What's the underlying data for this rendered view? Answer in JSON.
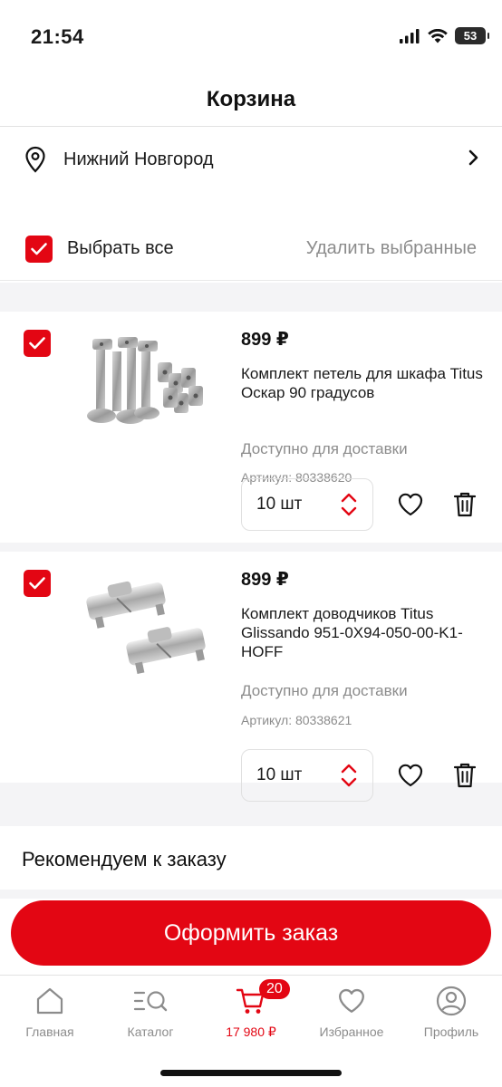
{
  "status_bar": {
    "time": "21:54",
    "battery": "53"
  },
  "header": {
    "title": "Корзина"
  },
  "location": {
    "city": "Нижний Новгород"
  },
  "selection": {
    "select_all_label": "Выбрать все",
    "delete_selected_label": "Удалить выбранные"
  },
  "items": [
    {
      "price": "899 ₽",
      "name": "Комплект петель для шкафа Titus Оскар 90 градусов",
      "availability": "Доступно для доставки",
      "sku": "Артикул: 80338620",
      "quantity": "10 шт"
    },
    {
      "price": "899 ₽",
      "name": "Комплект доводчиков Titus Glissando 951-0X94-050-00-K1-HOFF",
      "availability": "Доступно для доставки",
      "sku": "Артикул: 80338621",
      "quantity": "10 шт"
    }
  ],
  "recommend": {
    "title": "Рекомендуем к заказу"
  },
  "checkout": {
    "label": "Оформить заказ"
  },
  "tabs": [
    {
      "label": "Главная",
      "icon": "home-icon"
    },
    {
      "label": "Каталог",
      "icon": "catalog-search-icon"
    },
    {
      "label": "17 980 ₽",
      "icon": "cart-icon",
      "badge": "20"
    },
    {
      "label": "Избранное",
      "icon": "heart-icon"
    },
    {
      "label": "Профиль",
      "icon": "profile-icon"
    }
  ],
  "colors": {
    "accent": "#e30613",
    "muted_text": "#8c8c8c",
    "background_gray": "#f4f4f6"
  }
}
